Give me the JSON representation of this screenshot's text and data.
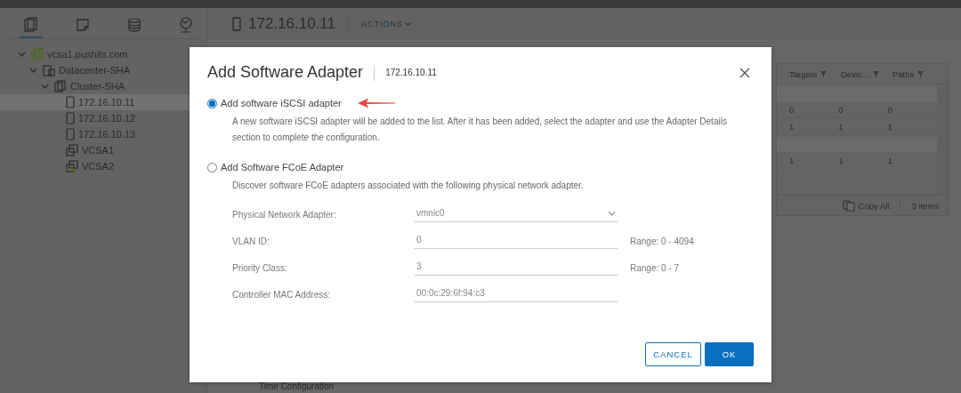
{
  "nav_tabs": [
    {
      "selected": true
    },
    {
      "selected": false
    },
    {
      "selected": false
    },
    {
      "selected": false
    }
  ],
  "tree": [
    {
      "label": "vcsa1.pushits.com",
      "kind": "vcenter",
      "expanded": true,
      "selected": false,
      "children": [
        {
          "label": "Datacenter-SHA",
          "kind": "datacenter",
          "expanded": true,
          "selected": false,
          "children": [
            {
              "label": "Cluster-SHA",
              "kind": "cluster",
              "expanded": true,
              "selected": false,
              "children": [
                {
                  "label": "172.16.10.11",
                  "kind": "host",
                  "selected": true
                },
                {
                  "label": "172.16.10.12",
                  "kind": "host",
                  "selected": false
                },
                {
                  "label": "172.16.10.13",
                  "kind": "host",
                  "selected": false
                },
                {
                  "label": "VCSA1",
                  "kind": "vm",
                  "selected": false
                },
                {
                  "label": "VCSA2",
                  "kind": "vm-running",
                  "selected": false
                }
              ]
            }
          ]
        }
      ]
    }
  ],
  "header": {
    "title": "172.16.10.11",
    "actions": "ACTIONS"
  },
  "table": {
    "columns": [
      "Targets",
      "Devic...",
      "Paths"
    ],
    "rows": [
      {
        "kind": "group"
      },
      {
        "kind": "data",
        "cells": [
          "0",
          "0",
          "0"
        ]
      },
      {
        "kind": "data",
        "cells": [
          "1",
          "1",
          "1"
        ]
      },
      {
        "kind": "group"
      },
      {
        "kind": "data",
        "cells": [
          "1",
          "1",
          "1"
        ]
      }
    ],
    "copy_all": "Copy All",
    "count": "3 items"
  },
  "bottom_text": "Time Configuration",
  "dialog": {
    "title": "Add Software Adapter",
    "host": "172.16.10.11",
    "options": [
      {
        "label": "Add software iSCSI adapter",
        "selected": true,
        "description": "A new software iSCSI adapter will be added to the list. After it has been added, select the adapter and use the Adapter Details section to complete the configuration."
      },
      {
        "label": "Add Software FCoE Adapter",
        "selected": false,
        "description": "Discover software FCoE adapters associated with the following physical network adapter.",
        "fields_disabled": true,
        "fields": [
          {
            "kind": "select",
            "label": "Physical Network Adapter:",
            "value": "vmnic0"
          },
          {
            "kind": "input",
            "label": "VLAN ID:",
            "value": "0",
            "hint": "Range: 0 - 4094"
          },
          {
            "kind": "input",
            "label": "Priority Class:",
            "value": "3",
            "hint": "Range: 0 - 7"
          },
          {
            "kind": "input",
            "label": "Controller MAC Address:",
            "value": "00:0c:29:6f:94:c3"
          }
        ]
      }
    ],
    "cancel": "CANCEL",
    "ok": "OK"
  }
}
